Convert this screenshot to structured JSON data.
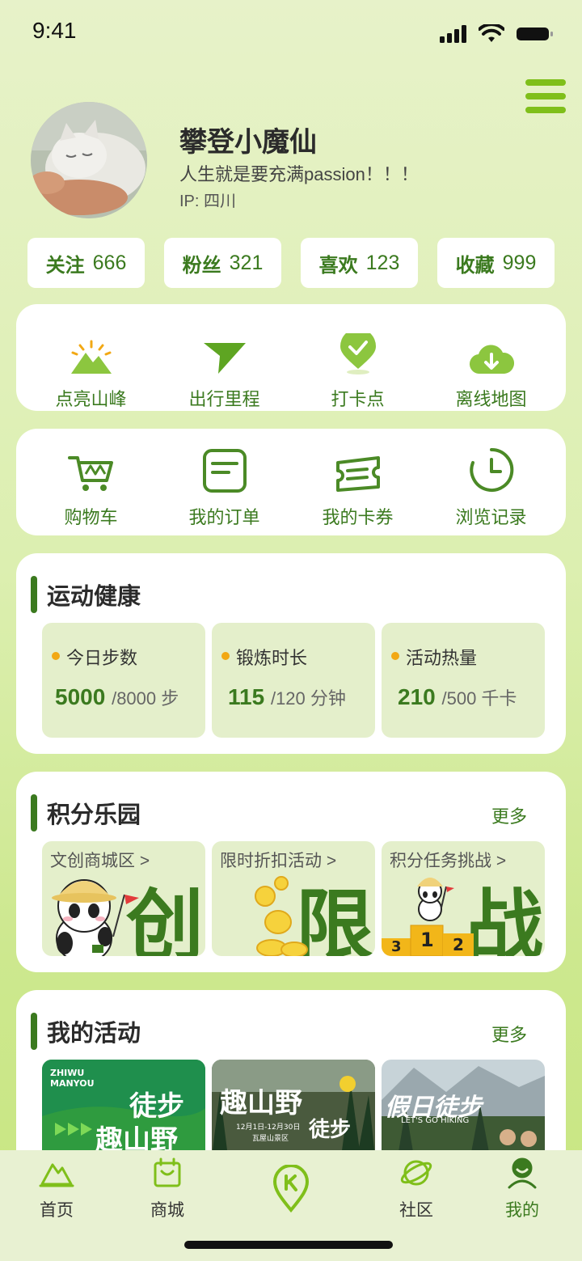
{
  "status_bar": {
    "time": "9:41"
  },
  "profile": {
    "name": "攀登小魔仙",
    "bio": "人生就是要充满passion！！！",
    "ip": "IP: 四川"
  },
  "stats": [
    {
      "label": "关注",
      "value": "666"
    },
    {
      "label": "粉丝",
      "value": "321"
    },
    {
      "label": "喜欢",
      "value": "123"
    },
    {
      "label": "收藏",
      "value": "999"
    }
  ],
  "quick_actions": [
    {
      "label": "点亮山峰",
      "icon": "mountain-sun-icon"
    },
    {
      "label": "出行里程",
      "icon": "paper-plane-icon"
    },
    {
      "label": "打卡点",
      "icon": "checkin-pin-icon"
    },
    {
      "label": "离线地图",
      "icon": "cloud-download-icon"
    }
  ],
  "shop_actions": [
    {
      "label": "购物车",
      "icon": "cart-icon"
    },
    {
      "label": "我的订单",
      "icon": "order-icon"
    },
    {
      "label": "我的卡券",
      "icon": "ticket-icon"
    },
    {
      "label": "浏览记录",
      "icon": "clock-icon"
    }
  ],
  "health": {
    "title": "运动健康",
    "items": [
      {
        "label": "今日步数",
        "value": "5000",
        "target": "/8000 步"
      },
      {
        "label": "锻炼时长",
        "value": "115",
        "target": "/120 分钟"
      },
      {
        "label": "活动热量",
        "value": "210",
        "target": "/500 千卡"
      }
    ]
  },
  "points": {
    "title": "积分乐园",
    "more": "更多",
    "items": [
      {
        "label": "文创商城区 >",
        "big": "创"
      },
      {
        "label": "限时折扣活动 >",
        "big": "限"
      },
      {
        "label": "积分任务挑战 >",
        "big": "战"
      }
    ],
    "podium": [
      "3",
      "1",
      "2"
    ]
  },
  "activities": {
    "title": "我的活动",
    "more": "更多",
    "banners": [
      {
        "brand": "ZHIWU MANYOU",
        "line1": "徒步",
        "line2": "趣山野"
      },
      {
        "line1": "趣山野",
        "line2": "徒步",
        "date": "12月1日-12月30日",
        "place": "瓦屋山景区"
      },
      {
        "line1": "假日徒步",
        "line2": "LET'S GO HIKING"
      }
    ]
  },
  "tabbar": [
    {
      "label": "首页",
      "icon": "mountain-icon"
    },
    {
      "label": "商城",
      "icon": "shop-bag-icon"
    },
    {
      "label": "",
      "icon": "location-pin-icon"
    },
    {
      "label": "社区",
      "icon": "planet-icon"
    },
    {
      "label": "我的",
      "icon": "person-icon"
    }
  ],
  "colors": {
    "accent": "#3b7a1f",
    "lime": "#7fbf1a",
    "bright": "#8cc63f",
    "orange": "#f2a814"
  }
}
